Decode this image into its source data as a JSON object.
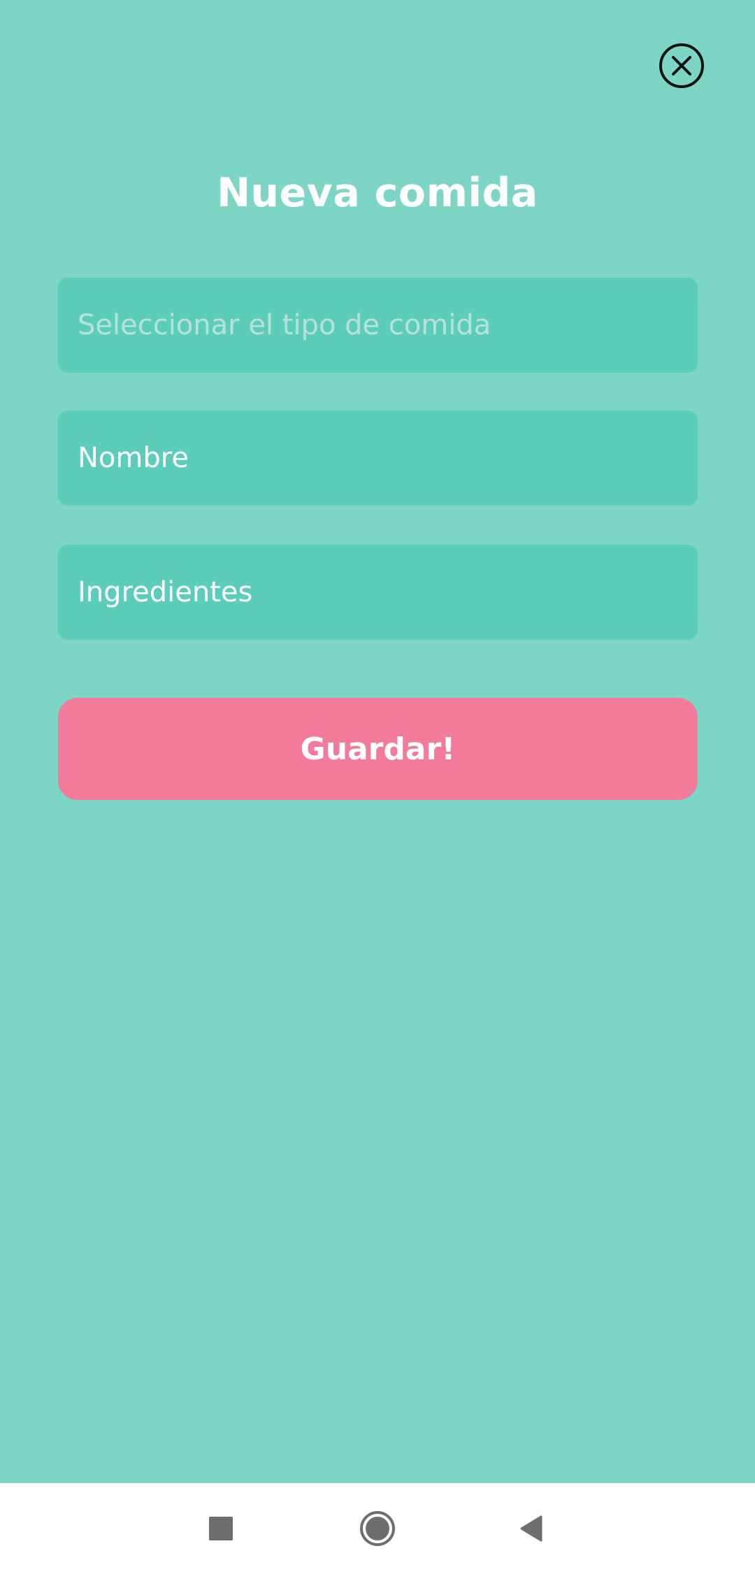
{
  "colors": {
    "background": "#7dd6c5",
    "field_background": "#5ccdb9",
    "accent_button": "#f27a9b",
    "text_light": "#ffffff",
    "placeholder_text": "#b6e2da",
    "nav_icon": "#6e6e6e"
  },
  "header": {
    "close_icon": "close-circle-icon",
    "title": "Nueva comida"
  },
  "form": {
    "meal_type": {
      "placeholder": "Seleccionar el tipo de comida",
      "value": ""
    },
    "name": {
      "placeholder": "Nombre",
      "value": ""
    },
    "ingredients": {
      "placeholder": "Ingredientes",
      "value": ""
    },
    "save_label": "Guardar!"
  },
  "navbar": {
    "recents_icon": "square-icon",
    "home_icon": "circle-icon",
    "back_icon": "triangle-left-icon"
  }
}
